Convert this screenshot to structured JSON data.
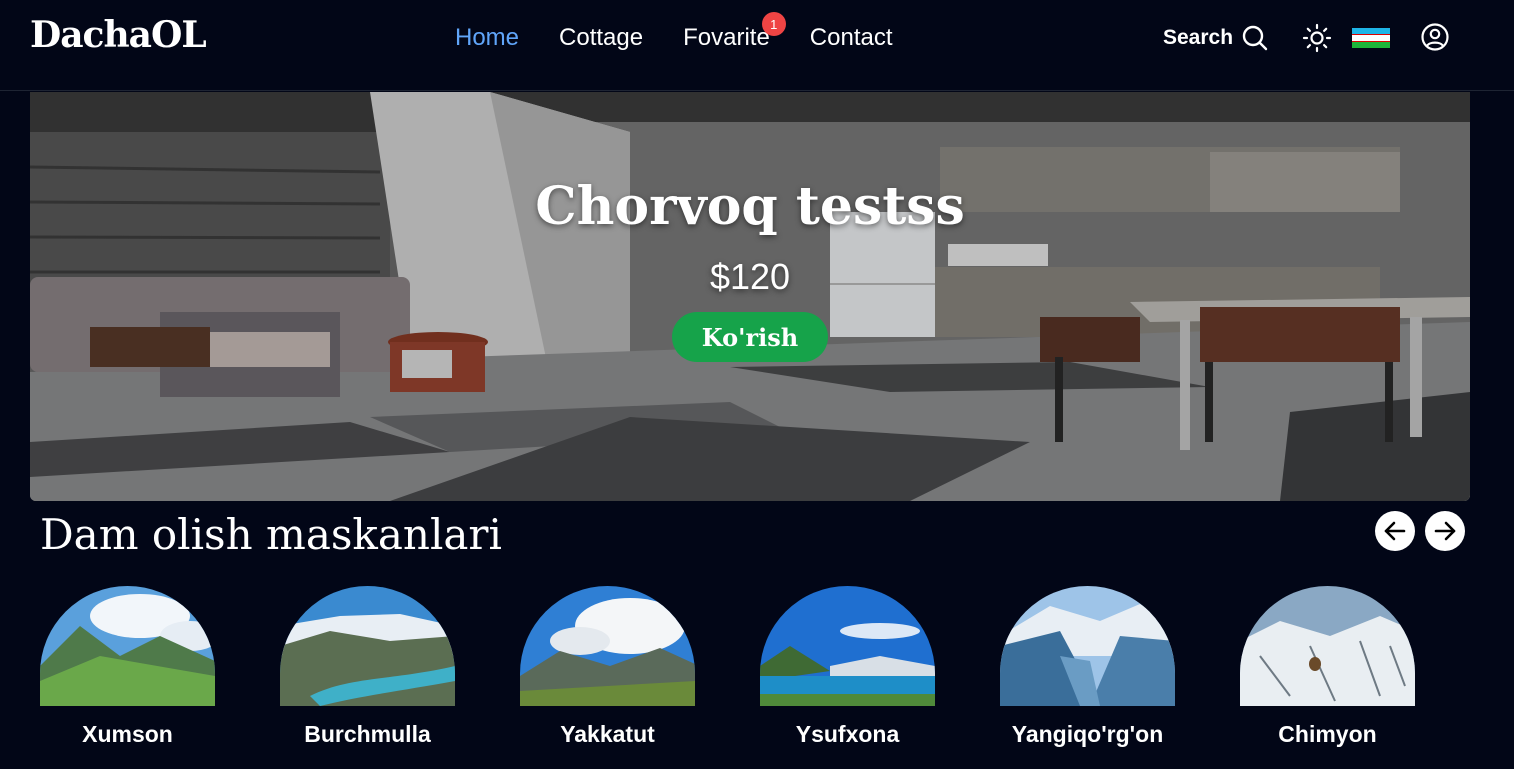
{
  "header": {
    "logo": "DachaOL",
    "nav": [
      {
        "label": "Home",
        "active": true
      },
      {
        "label": "Cottage",
        "active": false
      },
      {
        "label": "Fovarite",
        "active": false,
        "badge": "1"
      },
      {
        "label": "Contact",
        "active": false
      }
    ],
    "search_label": "Search",
    "icons": {
      "search": "search-icon",
      "theme": "sun-icon",
      "language": "uzbekistan-flag-icon",
      "account": "user-circle-icon"
    }
  },
  "hero": {
    "title": "Chorvoq testss",
    "price": "$120",
    "button_label": "Ko'rish"
  },
  "section": {
    "title": "Dam olish maskanlari",
    "prev_icon": "arrow-left-icon",
    "next_icon": "arrow-right-icon"
  },
  "places": [
    {
      "name": "Xumson"
    },
    {
      "name": "Burchmulla"
    },
    {
      "name": "Yakkatut"
    },
    {
      "name": "Ysufxona"
    },
    {
      "name": "Yangiqo'rg'on"
    },
    {
      "name": "Chimyon"
    }
  ],
  "colors": {
    "background": "#020617",
    "active_nav": "#60a5fa",
    "badge": "#ef4444",
    "button": "#16a34a"
  }
}
